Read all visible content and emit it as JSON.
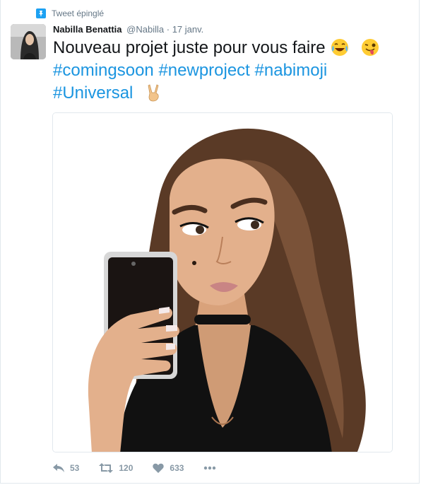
{
  "pinned_label": "Tweet épinglé",
  "author": {
    "name": "Nabilla Benattia",
    "handle": "@Nabilla",
    "separator": "·",
    "date": "17 janv."
  },
  "tweet": {
    "text": "Nouveau projet juste pour vous faire",
    "hashtags": [
      "#comingsoon",
      "#newproject",
      "#nabimoji",
      "#Universal"
    ],
    "emojis": [
      "tears-of-joy-icon",
      "winking-tongue-icon",
      "victory-hand-icon"
    ]
  },
  "actions": {
    "reply_count": "53",
    "retweet_count": "120",
    "like_count": "633"
  },
  "colors": {
    "hashtag": "#1b95e0",
    "pin": "#1da1f2",
    "muted": "#657786"
  }
}
